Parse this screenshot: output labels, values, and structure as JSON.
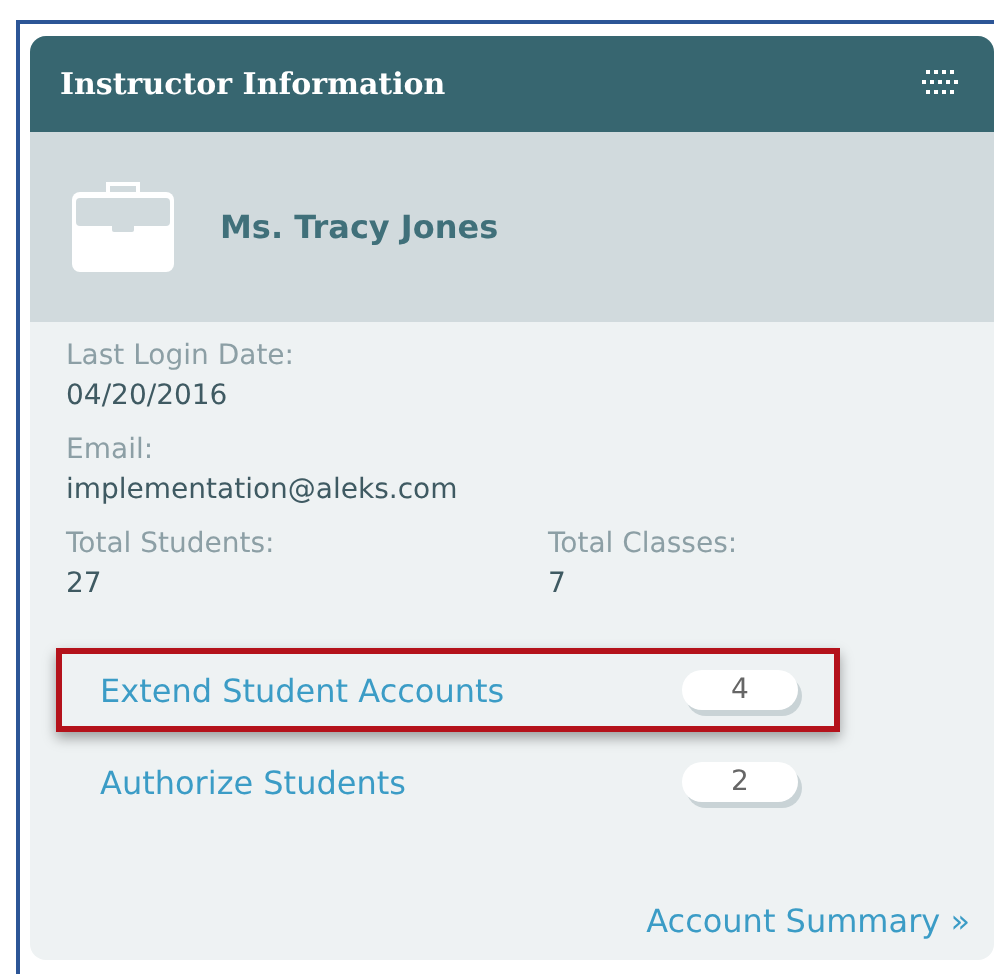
{
  "panel": {
    "title": "Instructor Information"
  },
  "profile": {
    "name": "Ms. Tracy Jones"
  },
  "fields": [
    {
      "label": "Last Login Date:",
      "value": "04/20/2016"
    },
    {
      "label": "Email:",
      "value": "implementation@aleks.com"
    }
  ],
  "stats": [
    {
      "label": "Total Students:",
      "value": "27"
    },
    {
      "label": "Total Classes:",
      "value": "7"
    }
  ],
  "links": [
    {
      "label": "Extend Student Accounts",
      "count": "4",
      "highlighted": true
    },
    {
      "label": "Authorize Students",
      "count": "2",
      "highlighted": false
    }
  ],
  "footer_link": "Account Summary »"
}
